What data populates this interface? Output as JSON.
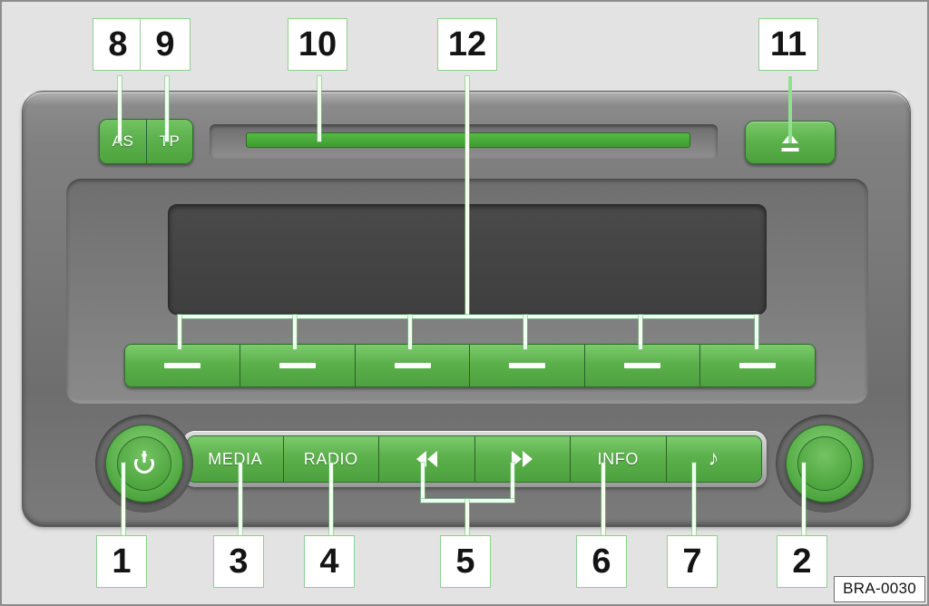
{
  "figure": {
    "id_label": "BRA-0030",
    "device": "car-radio-head-unit",
    "accent_green": "#5cb14c",
    "callout_border": "#8fd08f",
    "chassis_gray": "#7a7a7a",
    "display_gray": "#454545",
    "background_gray": "#e3e3e3"
  },
  "callouts": [
    {
      "n": "1",
      "target": "power-volume-knob"
    },
    {
      "n": "2",
      "target": "tuning-knob"
    },
    {
      "n": "3",
      "target": "media-button"
    },
    {
      "n": "4",
      "target": "radio-button"
    },
    {
      "n": "5",
      "target": "seek-buttons"
    },
    {
      "n": "6",
      "target": "info-button"
    },
    {
      "n": "7",
      "target": "sound-button"
    },
    {
      "n": "8",
      "target": "as-button"
    },
    {
      "n": "9",
      "target": "tp-button"
    },
    {
      "n": "10",
      "target": "cd-slot"
    },
    {
      "n": "11",
      "target": "eject-button"
    },
    {
      "n": "12",
      "target": "preset-buttons"
    }
  ],
  "top_buttons": {
    "as_label": "AS",
    "tp_label": "TP",
    "eject_icon": "eject-icon"
  },
  "presets": [
    {
      "label": ""
    },
    {
      "label": ""
    },
    {
      "label": ""
    },
    {
      "label": ""
    },
    {
      "label": ""
    },
    {
      "label": ""
    }
  ],
  "control_bar": [
    {
      "label": "MEDIA",
      "icon": ""
    },
    {
      "label": "RADIO",
      "icon": ""
    },
    {
      "label": "",
      "icon": "rewind-icon"
    },
    {
      "label": "",
      "icon": "fast-forward-icon"
    },
    {
      "label": "INFO",
      "icon": ""
    },
    {
      "label": "♪",
      "icon": "music-note-icon"
    }
  ],
  "knobs": {
    "left": {
      "name": "power-volume-knob",
      "icon": "power-icon"
    },
    "right": {
      "name": "tuning-knob",
      "icon": ""
    }
  }
}
